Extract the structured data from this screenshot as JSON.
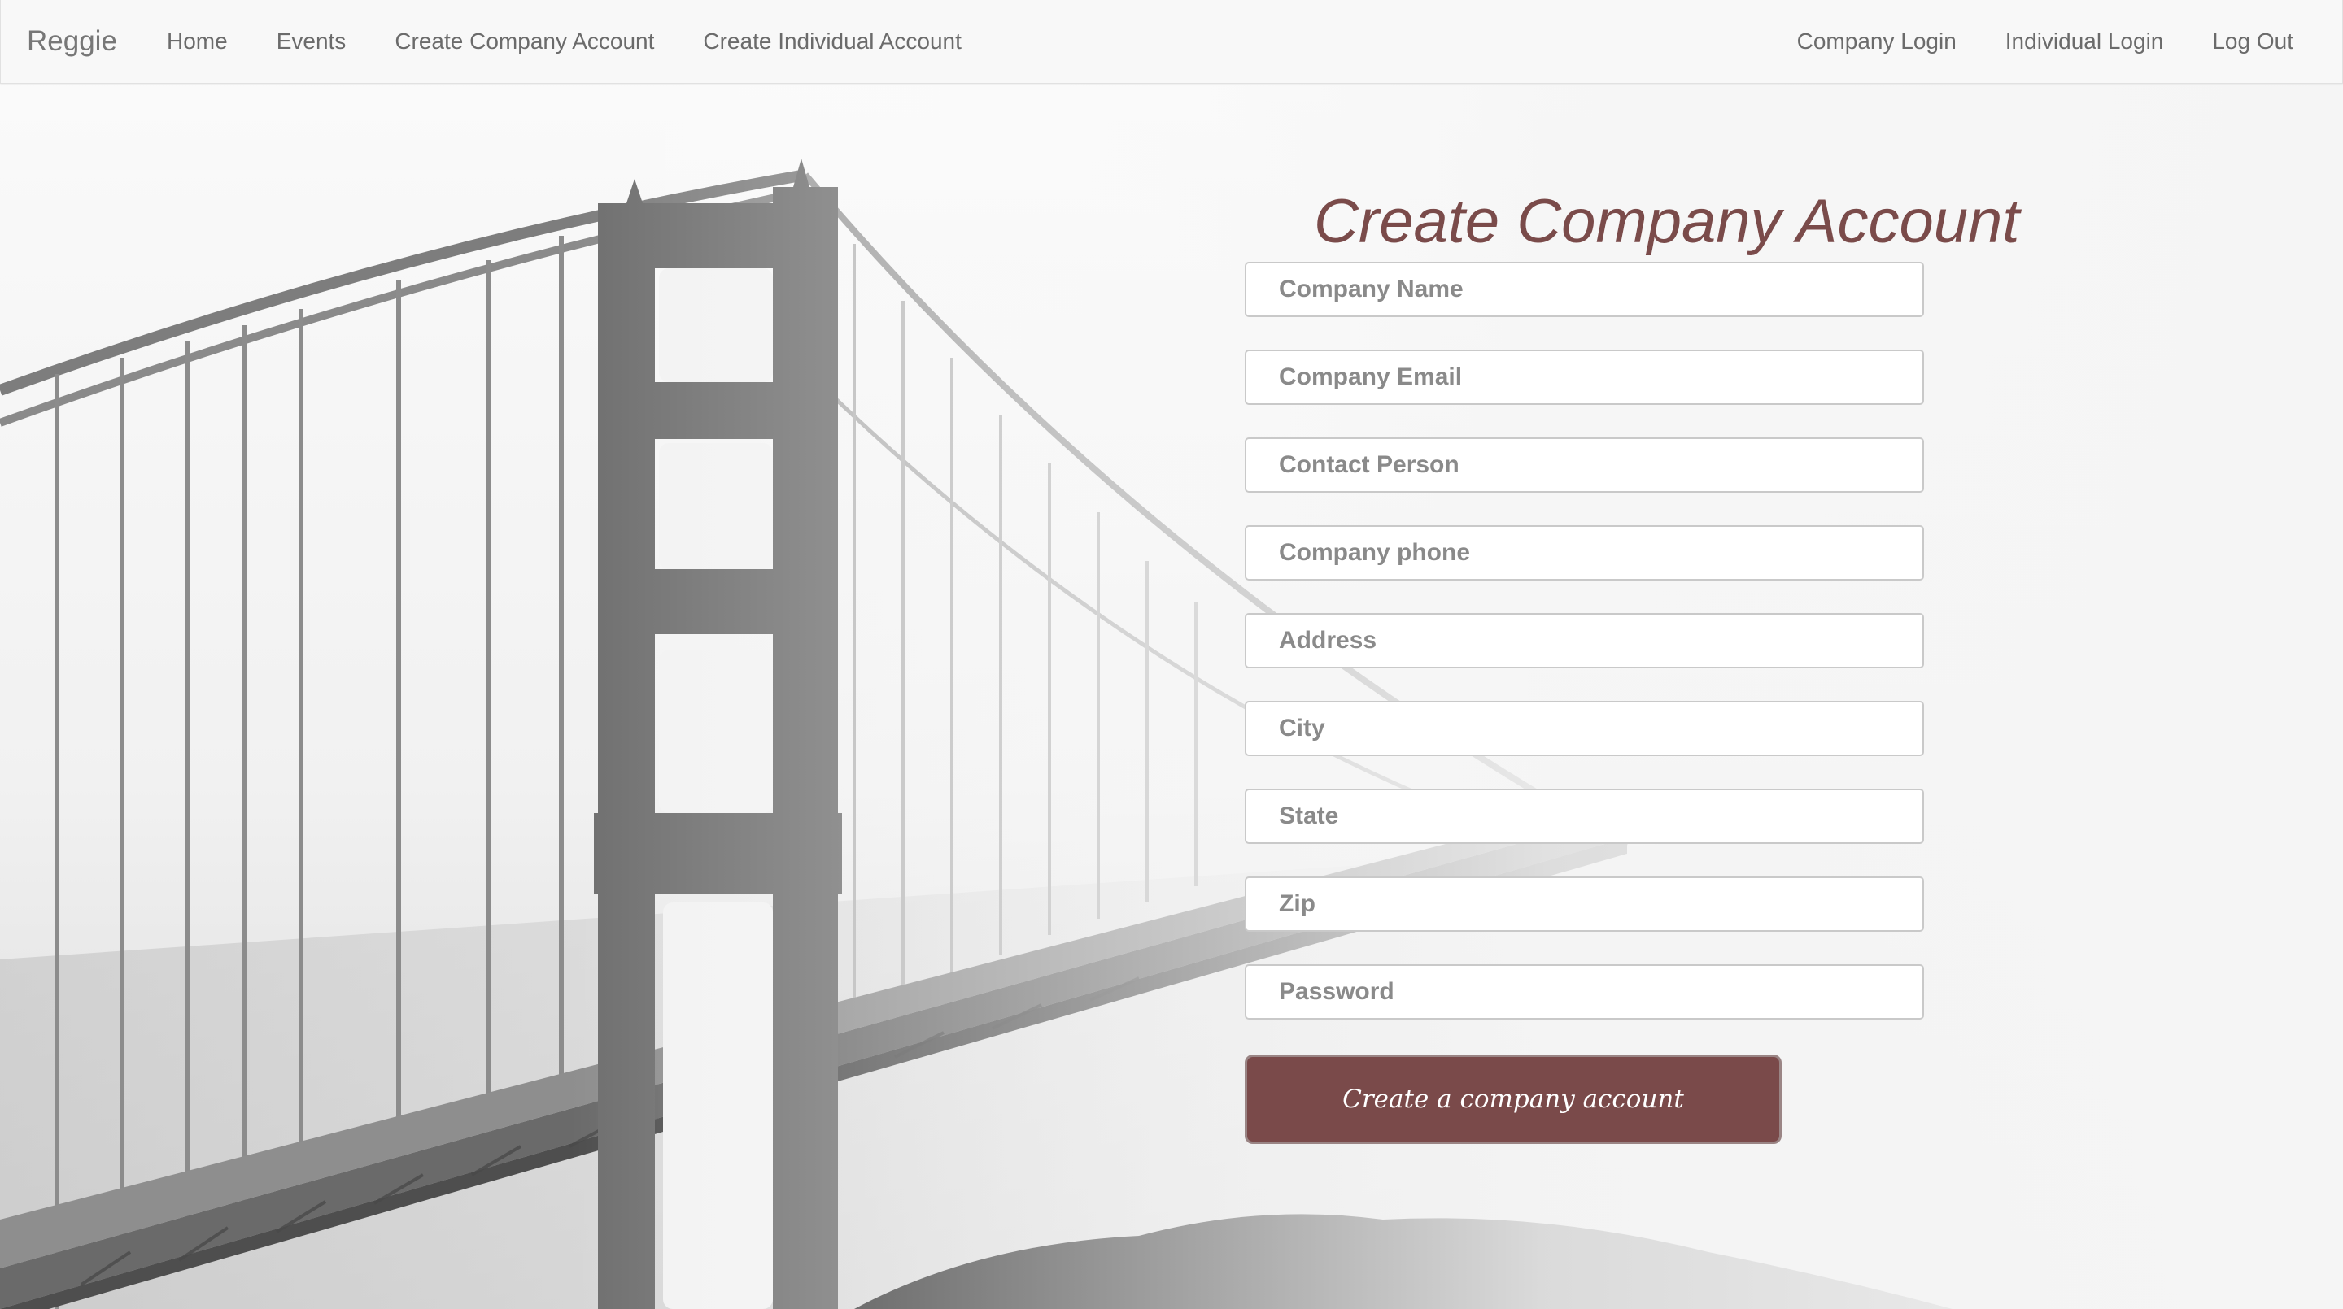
{
  "navbar": {
    "brand": "Reggie",
    "left_items": [
      {
        "label": "Home"
      },
      {
        "label": "Events"
      },
      {
        "label": "Create Company Account"
      },
      {
        "label": "Create Individual Account"
      }
    ],
    "right_items": [
      {
        "label": "Company Login"
      },
      {
        "label": "Individual Login"
      },
      {
        "label": "Log Out"
      }
    ]
  },
  "form": {
    "title": "Create Company Account",
    "fields": [
      {
        "placeholder": "Company Name",
        "value": ""
      },
      {
        "placeholder": "Company Email",
        "value": ""
      },
      {
        "placeholder": "Contact Person",
        "value": ""
      },
      {
        "placeholder": "Company phone",
        "value": ""
      },
      {
        "placeholder": "Address",
        "value": ""
      },
      {
        "placeholder": "City",
        "value": ""
      },
      {
        "placeholder": "State",
        "value": ""
      },
      {
        "placeholder": "Zip",
        "value": ""
      },
      {
        "placeholder": "Password",
        "value": ""
      }
    ],
    "submit_label": "Create a company account"
  },
  "colors": {
    "accent": "#7a4a4a",
    "title": "#7a4b4a",
    "navbar_bg": "#f8f8f8",
    "nav_text": "#6b6b6b"
  }
}
